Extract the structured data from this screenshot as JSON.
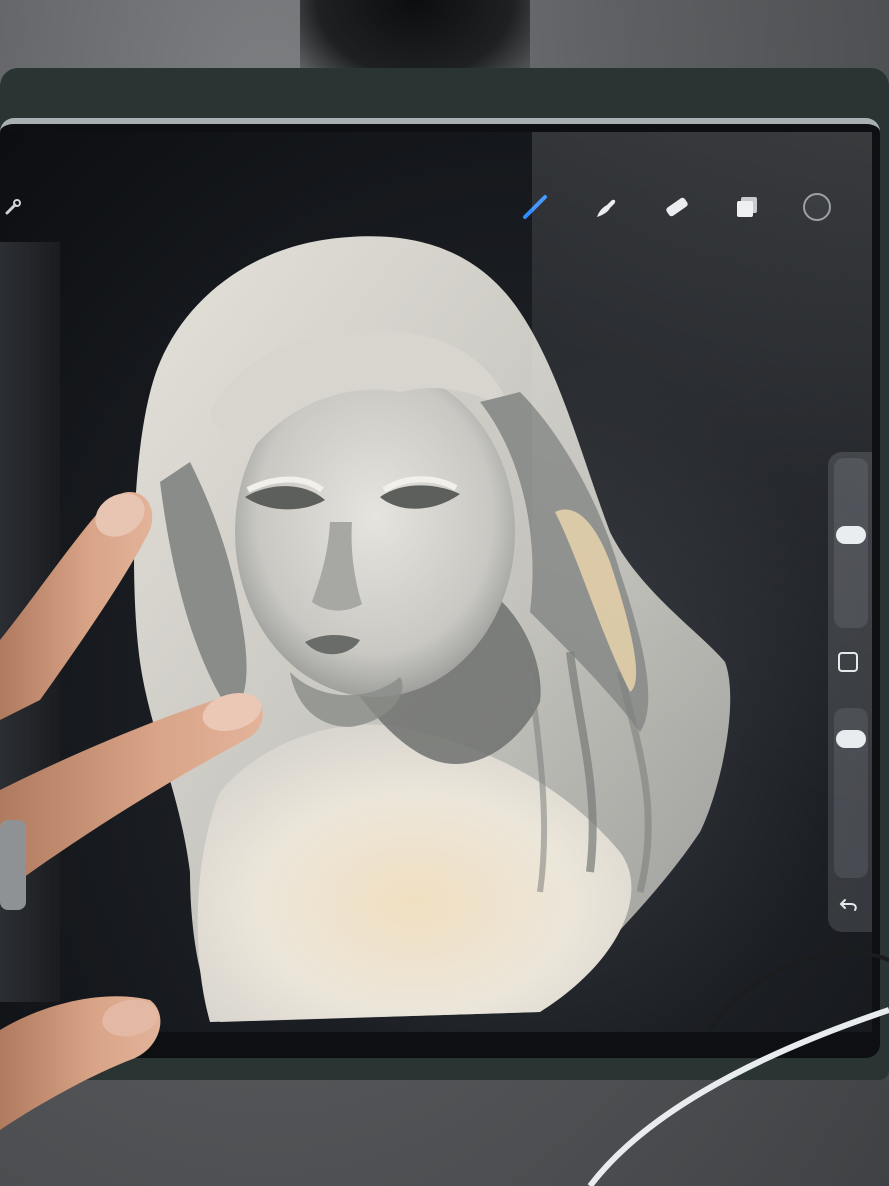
{
  "app": {
    "toolbar": {
      "icons": [
        "actions-wrench-icon",
        "brush-icon",
        "smudge-icon",
        "eraser-icon",
        "layers-icon",
        "color-swatch-icon"
      ],
      "active_tool": "brush",
      "accent_color": "#2f8cff"
    },
    "sidebar": {
      "icons": [
        "modify-square-icon",
        "undo-arrow-icon"
      ],
      "size_level": 0.55,
      "opacity_level": 0.15
    }
  },
  "colors": {
    "canvas_bg": "#1b1e23",
    "case": "#2a3433",
    "marble_light": "#eeeae2",
    "marble_shadow": "#7e817f",
    "skin_tint": "#efd9b8"
  }
}
